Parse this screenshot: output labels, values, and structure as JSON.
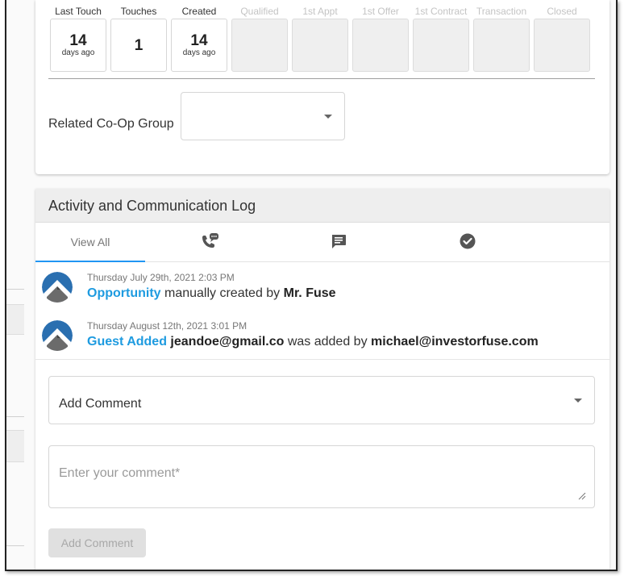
{
  "stages": [
    {
      "label": "Last Touch",
      "value": "14",
      "sub": "days ago",
      "active": true
    },
    {
      "label": "Touches",
      "value": "1",
      "sub": "",
      "active": true
    },
    {
      "label": "Created",
      "value": "14",
      "sub": "days ago",
      "active": true
    },
    {
      "label": "Qualified",
      "value": "",
      "sub": "",
      "active": false
    },
    {
      "label": "1st Appt",
      "value": "",
      "sub": "",
      "active": false
    },
    {
      "label": "1st Offer",
      "value": "",
      "sub": "",
      "active": false
    },
    {
      "label": "1st Contract",
      "value": "",
      "sub": "",
      "active": false
    },
    {
      "label": "Transaction",
      "value": "",
      "sub": "",
      "active": false
    },
    {
      "label": "Closed",
      "value": "",
      "sub": "",
      "active": false
    }
  ],
  "coop": {
    "label": "Related Co-Op Group",
    "value": ""
  },
  "log": {
    "title": "Activity and Communication Log",
    "tabs": [
      {
        "label": "View All",
        "icon": "",
        "active": true
      },
      {
        "label": "",
        "icon": "phone-chat-icon",
        "active": false
      },
      {
        "label": "",
        "icon": "message-icon",
        "active": false
      },
      {
        "label": "",
        "icon": "check-circle-icon",
        "active": false
      }
    ],
    "entries": [
      {
        "time": "Thursday July 29th, 2021 2:03 PM",
        "link": "Opportunity",
        "text1": " manually created by ",
        "strong1": "Mr. Fuse",
        "text2": "",
        "strong2": ""
      },
      {
        "time": "Thursday August 12th, 2021 3:01 PM",
        "link": "Guest Added",
        "text1": " ",
        "strong1": "jeandoe@gmail.co",
        "text2": " was added by ",
        "strong2": "michael@investorfuse.com"
      }
    ]
  },
  "comment": {
    "select_label": "Add Comment",
    "placeholder": "Enter your comment*",
    "button_label": "Add Comment"
  },
  "colors": {
    "accent": "#2196f3",
    "link": "#1e9be0",
    "disabled": "#e0e0e0"
  }
}
